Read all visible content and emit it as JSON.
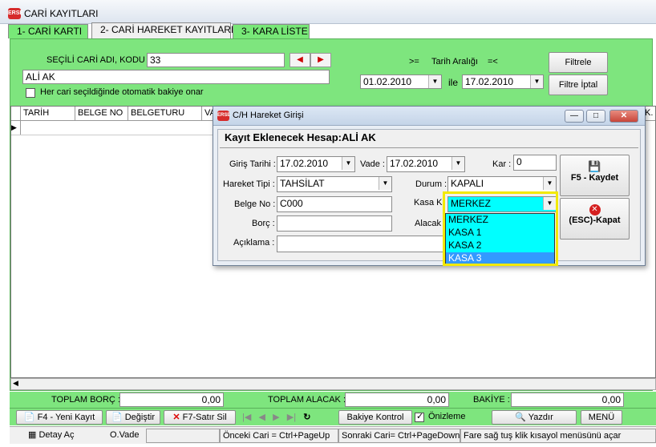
{
  "window": {
    "title": "CARİ KAYITLARI",
    "logo": "ERSE"
  },
  "tabs": [
    "1- CARİ KARTI",
    "2- CARİ HAREKET KAYITLARI",
    "3- KARA LİSTE"
  ],
  "filter": {
    "selected_label": "SEÇİLİ CARİ ADI, KODU :",
    "code": "33",
    "name": "ALİ AK",
    "auto_balance_label": "Her cari seçildiğinde otomatik bakiye onar",
    "gte": ">=",
    "date_range_label": "Tarih Aralığı",
    "lte": "=<",
    "date_from": "01.02.2010",
    "between": "ile",
    "date_to": "17.02.2010",
    "filter_btn": "Filtrele",
    "filter_cancel_btn": "Filtre İptal"
  },
  "grid": {
    "columns": [
      "TARİH",
      "BELGE NO",
      "BELGETURU",
      "VA"
    ],
    "right_edge_text": "K."
  },
  "dialog": {
    "title": "C/H Hareket Girişi",
    "header_label": "Kayıt Eklenecek Hesap:",
    "header_value": "ALİ AK",
    "giris_label": "Giriş Tarihi :",
    "giris_value": "17.02.2010",
    "vade_label": "Vade :",
    "vade_value": "17.02.2010",
    "kar_label": "Kar :",
    "kar_value": "0",
    "hareket_label": "Hareket Tipi :",
    "hareket_value": "TAHSİLAT",
    "durum_label": "Durum :",
    "durum_value": "KAPALI",
    "belge_label": "Belge No :",
    "belge_value": "C000",
    "kasa_label": "Kasa K",
    "kasa_value": "MERKEZ",
    "borc_label": "Borç :",
    "alacak_label": "Alacak",
    "aciklama_label": "Açıklama :",
    "save_btn": "F5 - Kaydet",
    "close_btn": "(ESC)-Kapat",
    "kasa_options": [
      "MERKEZ",
      "KASA 1",
      "KASA 2",
      "KASA 3"
    ],
    "kasa_highlighted": "KASA 3"
  },
  "totals": {
    "borc_label": "TOPLAM BORÇ :",
    "borc_value": "0,00",
    "alacak_label": "TOPLAM ALACAK :",
    "alacak_value": "0,00",
    "bakiye_label": "BAKİYE :",
    "bakiye_value": "0,00"
  },
  "toolbar": {
    "new": "F4 - Yeni Kayıt",
    "edit": "Değiştir",
    "delete": "F7-Satır Sil",
    "balance": "Bakiye Kontrol",
    "preview": "Önizleme",
    "print": "Yazdır",
    "menu": "MENÜ"
  },
  "status": {
    "detail": "Detay Aç",
    "ovade": "O.Vade",
    "prev": "Önceki Cari = Ctrl+PageUp",
    "next": "Sonraki Cari= Ctrl+PageDown",
    "hint": "Fare sağ tuş klik kısayol menüsünü açar"
  },
  "colors": {
    "panel": "#7ee57e",
    "dropdown": "#00ffff",
    "highlight": "#f2e900"
  }
}
